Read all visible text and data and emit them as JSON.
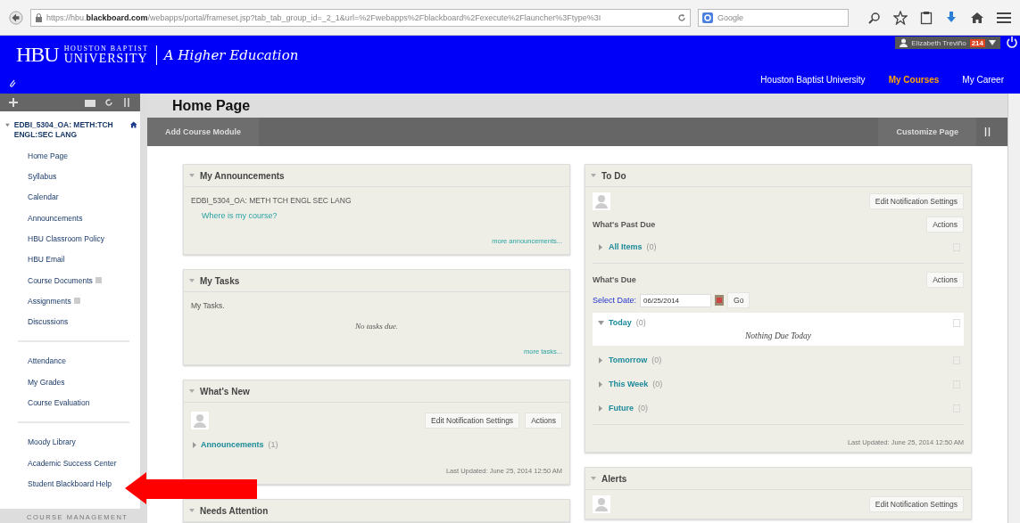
{
  "browser": {
    "url": "https://hbu.**blackboard.com**/webapps/portal/frameset.jsp?tab_tab_group_id=_2_1&url=%2Fwebapps%2Fblackboard%2Fexecute%2Flauncher%3Ftype%3I",
    "search": "Google"
  },
  "header": {
    "logo": "HBU",
    "logo_top": "HOUSTON BAPTIST",
    "logo_bottom": "UNIVERSITY",
    "tagline": "A Higher Education",
    "user": "Elizabeth Treviño",
    "badge": "214",
    "tabs": [
      {
        "label": "Houston Baptist University",
        "selected": false
      },
      {
        "label": "My Courses",
        "selected": true
      },
      {
        "label": "My Career",
        "selected": false
      }
    ]
  },
  "sidebar": {
    "course": "EDBI_5304_OA: METH:TCH ENGL:SEC LANG",
    "groups": [
      [
        {
          "label": "Home Page",
          "has_icon": false
        },
        {
          "label": "Syllabus",
          "has_icon": false
        },
        {
          "label": "Calendar",
          "has_icon": false
        },
        {
          "label": "Announcements",
          "has_icon": false
        },
        {
          "label": "HBU Classroom Policy",
          "has_icon": false
        },
        {
          "label": "HBU Email",
          "has_icon": false
        },
        {
          "label": "Course Documents",
          "has_icon": true
        },
        {
          "label": "Assignments",
          "has_icon": true
        },
        {
          "label": "Discussions",
          "has_icon": false
        }
      ],
      [
        {
          "label": "Attendance",
          "has_icon": false
        },
        {
          "label": "My Grades",
          "has_icon": false
        },
        {
          "label": "Course Evaluation",
          "has_icon": false
        }
      ],
      [
        {
          "label": "Moody Library",
          "has_icon": false
        },
        {
          "label": "Academic Success Center",
          "has_icon": false
        },
        {
          "label": "Student Blackboard Help",
          "has_icon": false
        }
      ]
    ],
    "section": "COURSE MANAGEMENT"
  },
  "page": {
    "title": "Home Page",
    "add_button": "Add Course Module",
    "customize_button": "Customize Page"
  },
  "left_column": [
    {
      "kind": "announcements",
      "title": "My Announcements",
      "course": "EDBI_5304_OA: METH TCH ENGL SEC LANG",
      "link": "Where is my course?",
      "more": "more announcements..."
    },
    {
      "kind": "tasks",
      "title": "My Tasks",
      "text": "My Tasks.",
      "empty": "No tasks due.",
      "more": "more tasks..."
    },
    {
      "kind": "whats_new",
      "title": "What's New",
      "notify_button": "Edit Notification Settings",
      "actions": "Actions",
      "groups": [
        {
          "label": "Announcements",
          "count": "(1)"
        }
      ],
      "updated": "Last Updated: June 25, 2014 12:50 AM"
    },
    {
      "kind": "header_only",
      "title": "Needs Attention"
    }
  ],
  "right_column": [
    {
      "kind": "todo",
      "title": "To Do",
      "notify_button": "Edit Notification Settings",
      "past_due": {
        "heading": "What's Past Due",
        "actions": "Actions",
        "groups": [
          {
            "label": "All Items",
            "count": "(0)",
            "expanded": false
          }
        ]
      },
      "due": {
        "heading": "What's Due",
        "actions": "Actions",
        "date_label": "Select Date:",
        "date_value": "06/25/2014",
        "go": "Go",
        "groups": [
          {
            "label": "Today",
            "count": "(0)",
            "expanded": true,
            "empty": "Nothing Due Today"
          },
          {
            "label": "Tomorrow",
            "count": "(0)",
            "expanded": false
          },
          {
            "label": "This Week",
            "count": "(0)",
            "expanded": false
          },
          {
            "label": "Future",
            "count": "(0)",
            "expanded": false
          }
        ]
      },
      "updated": "Last Updated: June 25, 2014 12:50 AM"
    },
    {
      "kind": "alerts",
      "title": "Alerts",
      "notify_button": "Edit Notification Settings"
    }
  ]
}
